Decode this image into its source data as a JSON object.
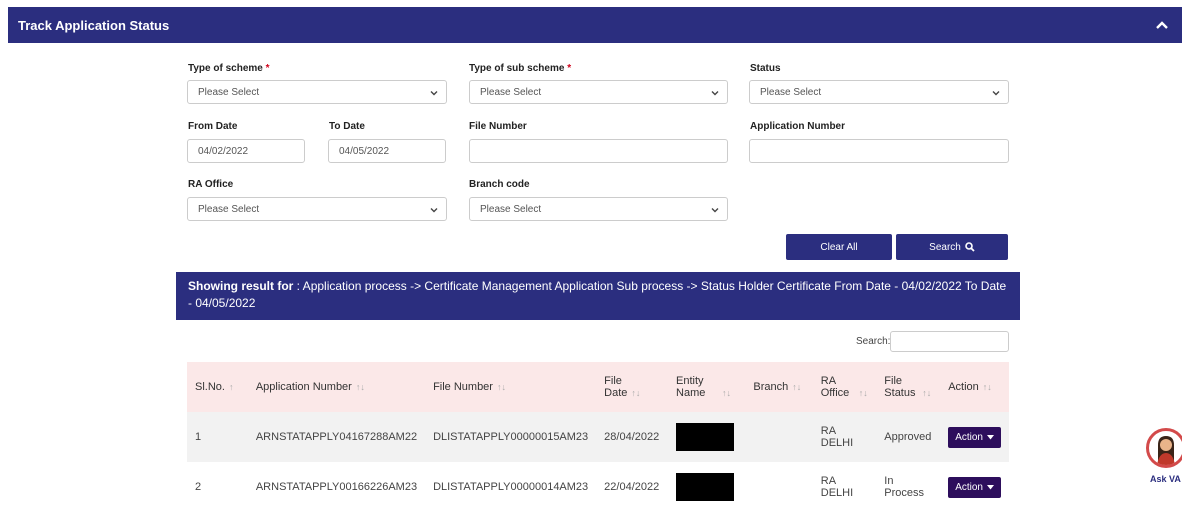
{
  "header": {
    "title": "Track Application Status"
  },
  "form": {
    "scheme_label": "Type of scheme",
    "subscheme_label": "Type of sub scheme",
    "status_label": "Status",
    "required_mark": "*",
    "placeholder": "Please Select",
    "from_date_label": "From Date",
    "from_date_value": "04/02/2022",
    "to_date_label": "To Date",
    "to_date_value": "04/05/2022",
    "file_number_label": "File Number",
    "application_number_label": "Application Number",
    "ra_office_label": "RA Office",
    "branch_code_label": "Branch code",
    "clear_label": "Clear All",
    "search_label": "Search"
  },
  "banner": {
    "lead": "Showing result for",
    "text": " : Application process -> Certificate Management Application Sub process -> Status Holder Certificate From Date - 04/02/2022 To Date - 04/05/2022"
  },
  "table": {
    "search_label": "Search:",
    "headers": [
      "Sl.No.",
      "Application Number",
      "File Number",
      "File Date",
      "Entity Name",
      "Branch",
      "RA Office",
      "File Status",
      "Action"
    ],
    "rows": [
      {
        "sl": "1",
        "app": "ARNSTATAPPLY04167288AM22",
        "file": "DLISTATAPPLY00000015AM23",
        "date": "28/04/2022",
        "branch": "",
        "ra": "RA DELHI",
        "status": "Approved",
        "action": "Action"
      },
      {
        "sl": "2",
        "app": "ARNSTATAPPLY00166226AM23",
        "file": "DLISTATAPPLY00000014AM23",
        "date": "22/04/2022",
        "branch": "",
        "ra": "RA DELHI",
        "status": "In Process",
        "action": "Action"
      }
    ]
  },
  "assistant": {
    "label": "Ask VA"
  },
  "colors": {
    "primary": "#2b2e7f",
    "action": "#2d0e5c",
    "header_row": "#fbe8e8",
    "required": "#d0021b"
  }
}
